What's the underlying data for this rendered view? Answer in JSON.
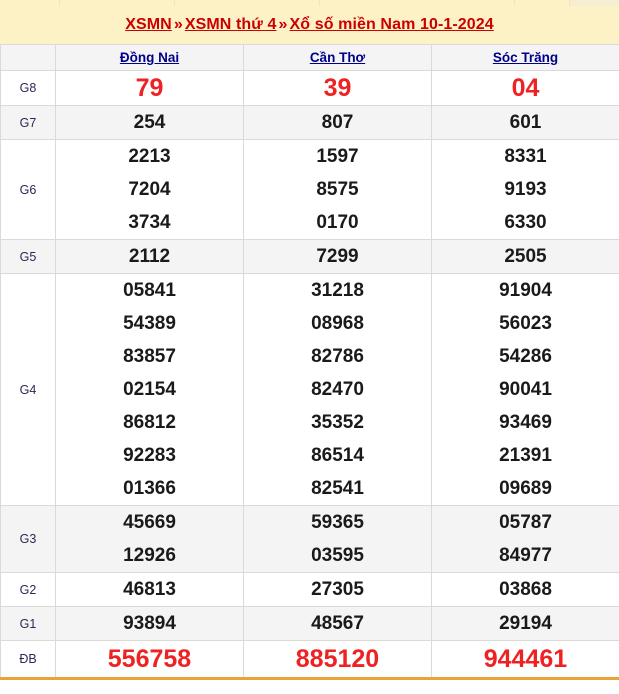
{
  "banner": {
    "crumbs": [
      {
        "label": "XSMN"
      },
      {
        "label": "XSMN thứ 4"
      },
      {
        "label": "Xổ số miền Nam 10-1-2024"
      }
    ],
    "separator": "»",
    "bg_color": "#fdf1c6",
    "link_color": "#cc0000"
  },
  "table": {
    "corner_label": "",
    "provinces": [
      "Đồng Nai",
      "Cần Thơ",
      "Sóc Trăng"
    ],
    "header_color": "#00008b",
    "special_color": "#ee2222",
    "rows": [
      {
        "prize": "G8",
        "highlight": true,
        "values": [
          [
            "79"
          ],
          [
            "39"
          ],
          [
            "04"
          ]
        ]
      },
      {
        "prize": "G7",
        "highlight": false,
        "values": [
          [
            "254"
          ],
          [
            "807"
          ],
          [
            "601"
          ]
        ]
      },
      {
        "prize": "G6",
        "highlight": false,
        "values": [
          [
            "2213",
            "7204",
            "3734"
          ],
          [
            "1597",
            "8575",
            "0170"
          ],
          [
            "8331",
            "9193",
            "6330"
          ]
        ]
      },
      {
        "prize": "G5",
        "highlight": false,
        "values": [
          [
            "2112"
          ],
          [
            "7299"
          ],
          [
            "2505"
          ]
        ]
      },
      {
        "prize": "G4",
        "highlight": false,
        "values": [
          [
            "05841",
            "54389",
            "83857",
            "02154",
            "86812",
            "92283",
            "01366"
          ],
          [
            "31218",
            "08968",
            "82786",
            "82470",
            "35352",
            "86514",
            "82541"
          ],
          [
            "91904",
            "56023",
            "54286",
            "90041",
            "93469",
            "21391",
            "09689"
          ]
        ]
      },
      {
        "prize": "G3",
        "highlight": false,
        "values": [
          [
            "45669",
            "12926"
          ],
          [
            "59365",
            "03595"
          ],
          [
            "05787",
            "84977"
          ]
        ]
      },
      {
        "prize": "G2",
        "highlight": false,
        "values": [
          [
            "46813"
          ],
          [
            "27305"
          ],
          [
            "03868"
          ]
        ]
      },
      {
        "prize": "G1",
        "highlight": false,
        "values": [
          [
            "93894"
          ],
          [
            "48567"
          ],
          [
            "29194"
          ]
        ]
      },
      {
        "prize": "ĐB",
        "highlight": true,
        "values": [
          [
            "556758"
          ],
          [
            "885120"
          ],
          [
            "944461"
          ]
        ]
      }
    ]
  }
}
